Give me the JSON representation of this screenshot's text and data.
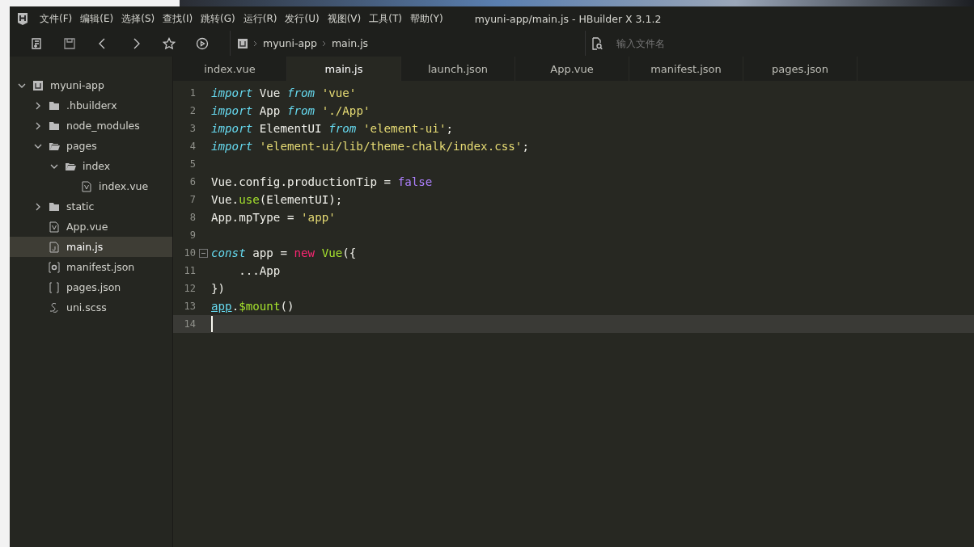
{
  "window": {
    "title": "myuni-app/main.js - HBuilder X 3.1.2"
  },
  "menu": [
    "文件(F)",
    "编辑(E)",
    "选择(S)",
    "查找(I)",
    "跳转(G)",
    "运行(R)",
    "发行(U)",
    "视图(V)",
    "工具(T)",
    "帮助(Y)"
  ],
  "breadcrumb": [
    "myuni-app",
    "main.js"
  ],
  "file_search": {
    "placeholder": "输入文件名"
  },
  "tabs": [
    {
      "label": "index.vue",
      "selected": false
    },
    {
      "label": "main.js",
      "selected": true
    },
    {
      "label": "launch.json",
      "selected": false
    },
    {
      "label": "App.vue",
      "selected": false
    },
    {
      "label": "manifest.json",
      "selected": false
    },
    {
      "label": "pages.json",
      "selected": false
    }
  ],
  "tree": [
    {
      "label": "myuni-app",
      "kind": "project",
      "expanded": true,
      "selected": false,
      "children": [
        {
          "label": ".hbuilderx",
          "kind": "folder",
          "expanded": false,
          "selected": false
        },
        {
          "label": "node_modules",
          "kind": "folder",
          "expanded": false,
          "selected": false
        },
        {
          "label": "pages",
          "kind": "folder",
          "expanded": true,
          "selected": false,
          "children": [
            {
              "label": "index",
              "kind": "folder",
              "expanded": true,
              "selected": false,
              "children": [
                {
                  "label": "index.vue",
                  "kind": "vue",
                  "selected": false
                }
              ]
            }
          ]
        },
        {
          "label": "static",
          "kind": "folder",
          "expanded": false,
          "selected": false
        },
        {
          "label": "App.vue",
          "kind": "vue",
          "selected": false
        },
        {
          "label": "main.js",
          "kind": "js",
          "selected": true
        },
        {
          "label": "manifest.json",
          "kind": "settings",
          "selected": false
        },
        {
          "label": "pages.json",
          "kind": "brackets",
          "selected": false
        },
        {
          "label": "uni.scss",
          "kind": "style",
          "selected": false
        }
      ]
    }
  ],
  "editor": {
    "lines": [
      {
        "number": "1",
        "tokens": [
          {
            "kind": "keyword",
            "text": "import"
          },
          {
            "kind": "plain",
            "text": " Vue "
          },
          {
            "kind": "keyword",
            "text": "from"
          },
          {
            "kind": "string",
            "text": " 'vue'"
          }
        ]
      },
      {
        "number": "2",
        "tokens": [
          {
            "kind": "keyword",
            "text": "import"
          },
          {
            "kind": "plain",
            "text": " App "
          },
          {
            "kind": "keyword",
            "text": "from"
          },
          {
            "kind": "string",
            "text": " './App'"
          }
        ]
      },
      {
        "number": "3",
        "tokens": [
          {
            "kind": "keyword",
            "text": "import"
          },
          {
            "kind": "plain",
            "text": " ElementUI "
          },
          {
            "kind": "keyword",
            "text": "from"
          },
          {
            "kind": "string",
            "text": " 'element-ui'"
          },
          {
            "kind": "plain",
            "text": ";"
          }
        ]
      },
      {
        "number": "4",
        "tokens": [
          {
            "kind": "keyword",
            "text": "import"
          },
          {
            "kind": "string",
            "text": " 'element-ui/lib/theme-chalk/index.css'"
          },
          {
            "kind": "plain",
            "text": ";"
          }
        ]
      },
      {
        "number": "5"
      },
      {
        "number": "6",
        "tokens": [
          {
            "kind": "plain",
            "text": "Vue.config.productionTip = "
          },
          {
            "kind": "constant",
            "text": "false"
          }
        ]
      },
      {
        "number": "7",
        "tokens": [
          {
            "kind": "plain",
            "text": "Vue."
          },
          {
            "kind": "function",
            "text": "use"
          },
          {
            "kind": "plain",
            "text": "(ElementUI);"
          }
        ]
      },
      {
        "number": "8",
        "tokens": [
          {
            "kind": "plain",
            "text": "App.mpType = "
          },
          {
            "kind": "string",
            "text": "'app'"
          }
        ]
      },
      {
        "number": "9"
      },
      {
        "number": "10",
        "fold": true,
        "tokens": [
          {
            "kind": "keyword",
            "text": "const"
          },
          {
            "kind": "plain",
            "text": " app = "
          },
          {
            "kind": "operator",
            "text": "new"
          },
          {
            "kind": "function",
            "text": " Vue"
          },
          {
            "kind": "plain",
            "text": "({"
          }
        ]
      },
      {
        "number": "11",
        "tokens": [
          {
            "kind": "plain",
            "text": "    ...App"
          }
        ]
      },
      {
        "number": "12",
        "tokens": [
          {
            "kind": "plain",
            "text": "})"
          }
        ]
      },
      {
        "number": "13",
        "tokens": [
          {
            "kind": "link",
            "text": "app"
          },
          {
            "kind": "plain",
            "text": "."
          },
          {
            "kind": "function",
            "text": "$mount"
          },
          {
            "kind": "plain",
            "text": "()"
          }
        ]
      },
      {
        "number": "14",
        "current": true
      }
    ]
  }
}
